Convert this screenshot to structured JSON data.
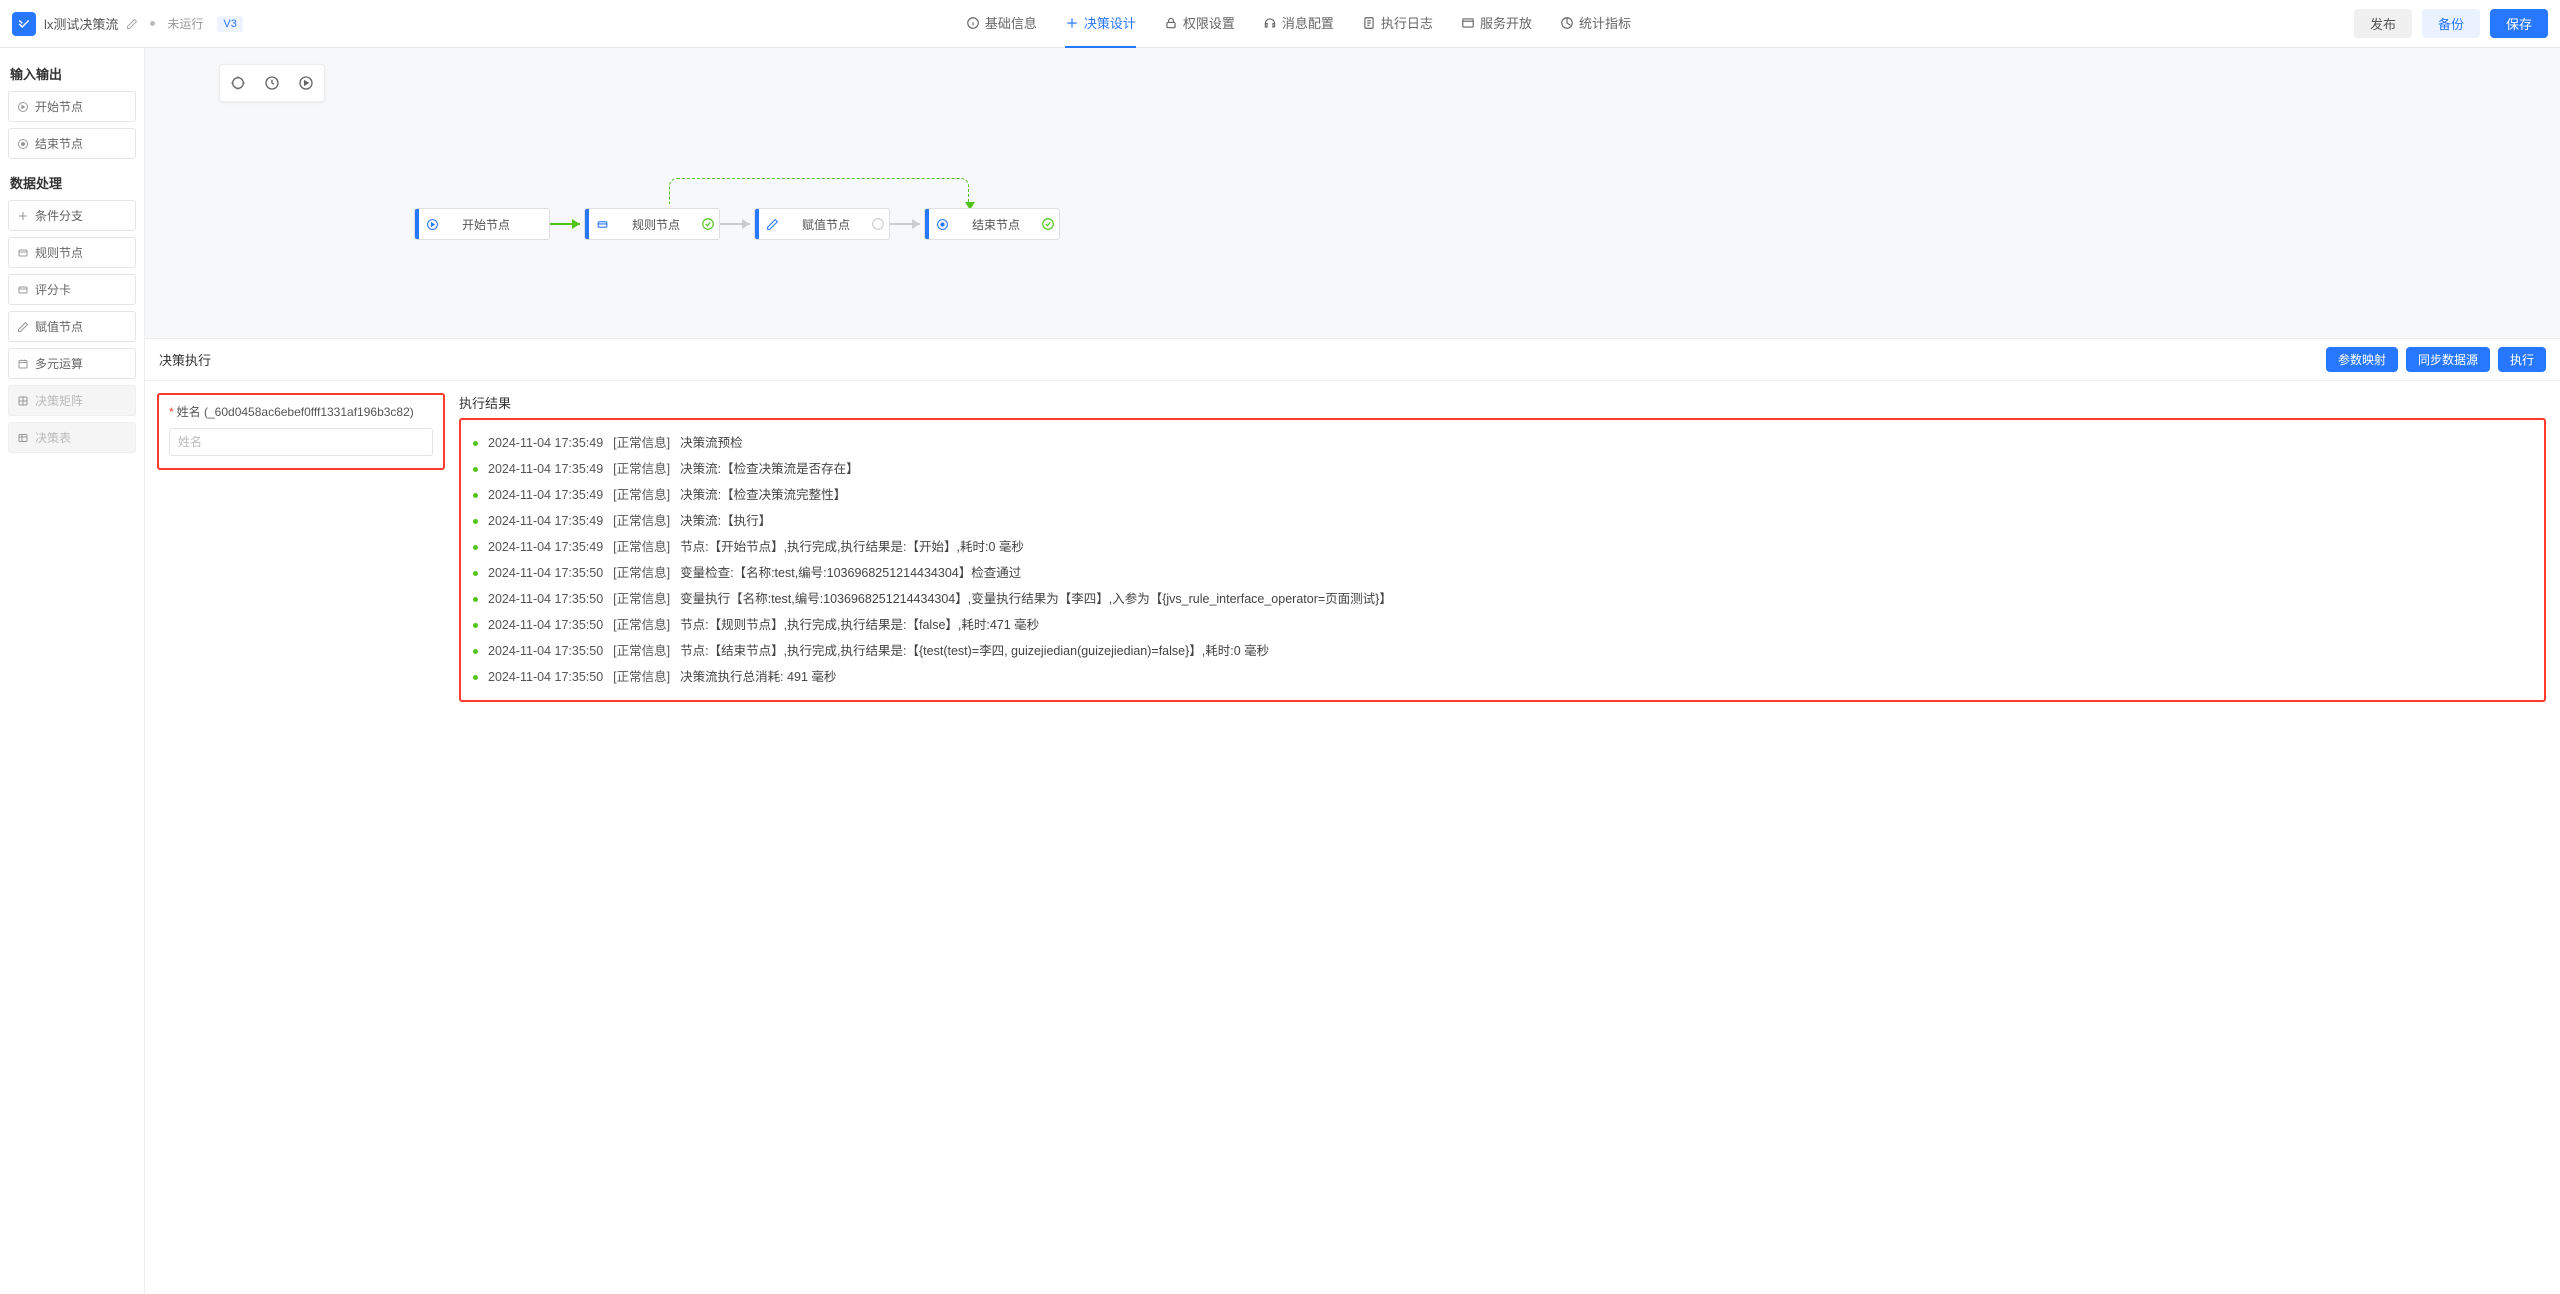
{
  "header": {
    "app_title": "lx测试决策流",
    "status": "未运行",
    "version": "V3",
    "tabs": [
      {
        "label": "基础信息"
      },
      {
        "label": "决策设计"
      },
      {
        "label": "权限设置"
      },
      {
        "label": "消息配置"
      },
      {
        "label": "执行日志"
      },
      {
        "label": "服务开放"
      },
      {
        "label": "统计指标"
      }
    ],
    "btn_publish": "发布",
    "btn_backup": "备份",
    "btn_save": "保存"
  },
  "sidebar": {
    "section1_title": "输入输出",
    "section1_items": [
      {
        "label": "开始节点"
      },
      {
        "label": "结束节点"
      }
    ],
    "section2_title": "数据处理",
    "section2_items": [
      {
        "label": "条件分支"
      },
      {
        "label": "规则节点"
      },
      {
        "label": "评分卡"
      },
      {
        "label": "赋值节点"
      },
      {
        "label": "多元运算"
      },
      {
        "label": "决策矩阵",
        "disabled": true
      },
      {
        "label": "决策表",
        "disabled": true
      }
    ]
  },
  "flow": {
    "nodes": [
      {
        "label": "开始节点",
        "status": "none"
      },
      {
        "label": "规则节点",
        "status": "ok"
      },
      {
        "label": "赋值节点",
        "status": "pending"
      },
      {
        "label": "结束节点",
        "status": "ok"
      }
    ]
  },
  "exec": {
    "panel_title": "决策执行",
    "btn_param": "参数映射",
    "btn_sync": "同步数据源",
    "btn_run": "执行",
    "form_label": "姓名 (_60d0458ac6ebef0fff1331af196b3c82)",
    "form_placeholder": "姓名",
    "result_title": "执行结果",
    "logs": [
      {
        "time": "2024-11-04 17:35:49",
        "level": "[正常信息]",
        "msg": "决策流预检"
      },
      {
        "time": "2024-11-04 17:35:49",
        "level": "[正常信息]",
        "msg": "决策流:【检查决策流是否存在】"
      },
      {
        "time": "2024-11-04 17:35:49",
        "level": "[正常信息]",
        "msg": "决策流:【检查决策流完整性】"
      },
      {
        "time": "2024-11-04 17:35:49",
        "level": "[正常信息]",
        "msg": "决策流:【执行】"
      },
      {
        "time": "2024-11-04 17:35:49",
        "level": "[正常信息]",
        "msg": "节点:【开始节点】,执行完成,执行结果是:【开始】,耗时:0 毫秒"
      },
      {
        "time": "2024-11-04 17:35:50",
        "level": "[正常信息]",
        "msg": "变量检查:【名称:test,编号:1036968251214434304】检查通过"
      },
      {
        "time": "2024-11-04 17:35:50",
        "level": "[正常信息]",
        "msg": "变量执行【名称:test,编号:1036968251214434304】,变量执行结果为【李四】,入参为【{jvs_rule_interface_operator=页面测试}】"
      },
      {
        "time": "2024-11-04 17:35:50",
        "level": "[正常信息]",
        "msg": "节点:【规则节点】,执行完成,执行结果是:【false】,耗时:471 毫秒"
      },
      {
        "time": "2024-11-04 17:35:50",
        "level": "[正常信息]",
        "msg": "节点:【结束节点】,执行完成,执行结果是:【{test(test)=李四, guizejiedian(guizejiedian)=false}】,耗时:0 毫秒"
      },
      {
        "time": "2024-11-04 17:35:50",
        "level": "[正常信息]",
        "msg": "决策流执行总消耗: 491 毫秒"
      }
    ]
  }
}
